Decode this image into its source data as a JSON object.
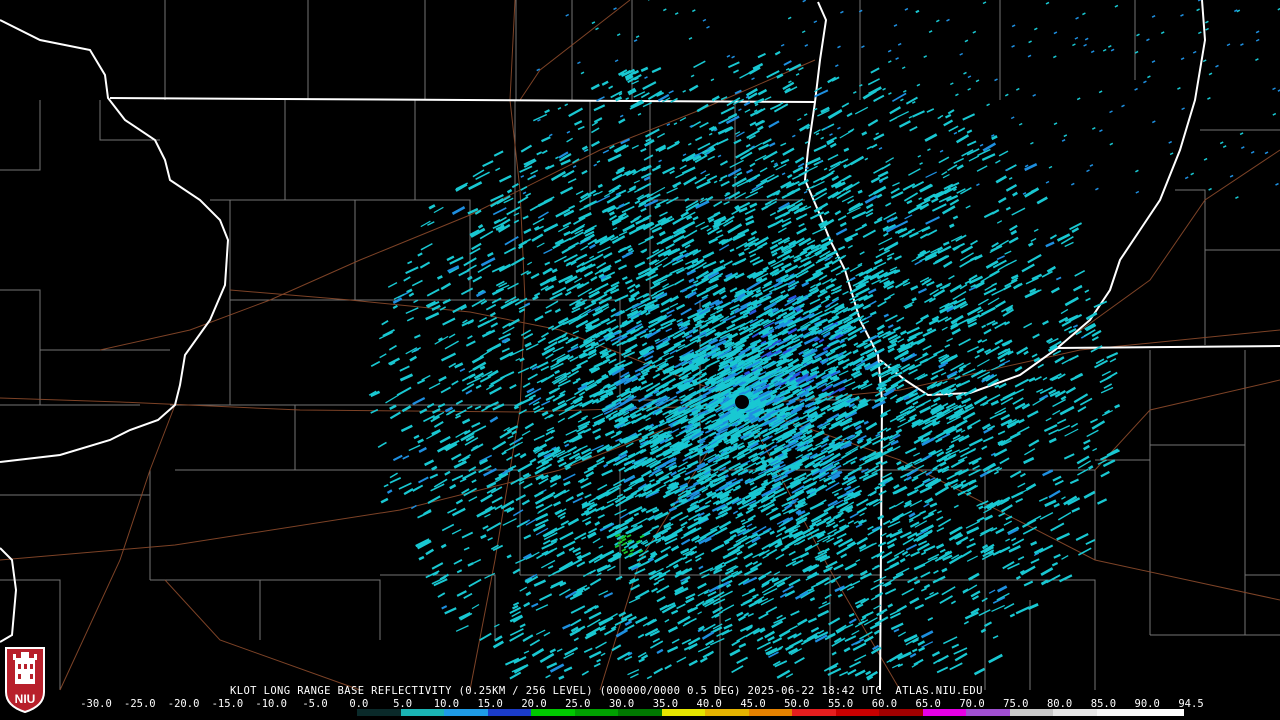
{
  "product": {
    "site": "KLOT",
    "text": "KLOT LONG RANGE BASE REFLECTIVITY (0.25KM / 256 LEVEL) (000000/0000 0.5 DEG) 2025-06-22 18:42 UTC  ATLAS.NIU.EDU"
  },
  "colors": {
    "background": "#000000",
    "state_border": "#ffffff",
    "county_border": "#8a8a8a",
    "highway": "#8b4a2b",
    "echo_light": "#19c8d2",
    "echo_mid": "#1e8fe0",
    "echo_strong": "#2a56e0",
    "echo_green": "#19c832"
  },
  "legend": {
    "labels": [
      "-30.0",
      "-25.0",
      "-20.0",
      "-15.0",
      "-10.0",
      "-5.0",
      "0.0",
      "5.0",
      "10.0",
      "15.0",
      "20.0",
      "25.0",
      "30.0",
      "35.0",
      "40.0",
      "45.0",
      "50.0",
      "55.0",
      "60.0",
      "65.0",
      "70.0",
      "75.0",
      "80.0",
      "85.0",
      "90.0",
      "94.5"
    ],
    "bar_colors": [
      "#000000",
      "#000000",
      "#000000",
      "#000000",
      "#000000",
      "#000000",
      "#0a2a2a",
      "#1ab4b4",
      "#1e9be6",
      "#1a3cc8",
      "#00c800",
      "#00a000",
      "#007800",
      "#e6e600",
      "#e6b400",
      "#e68200",
      "#e61e1e",
      "#c80000",
      "#a00000",
      "#e600e6",
      "#a050d0",
      "#c8c8c8",
      "#e6e6e6",
      "#f5f5f5",
      "#ffffff"
    ]
  },
  "logo": {
    "text": "NIU",
    "color": "#b8202b"
  }
}
